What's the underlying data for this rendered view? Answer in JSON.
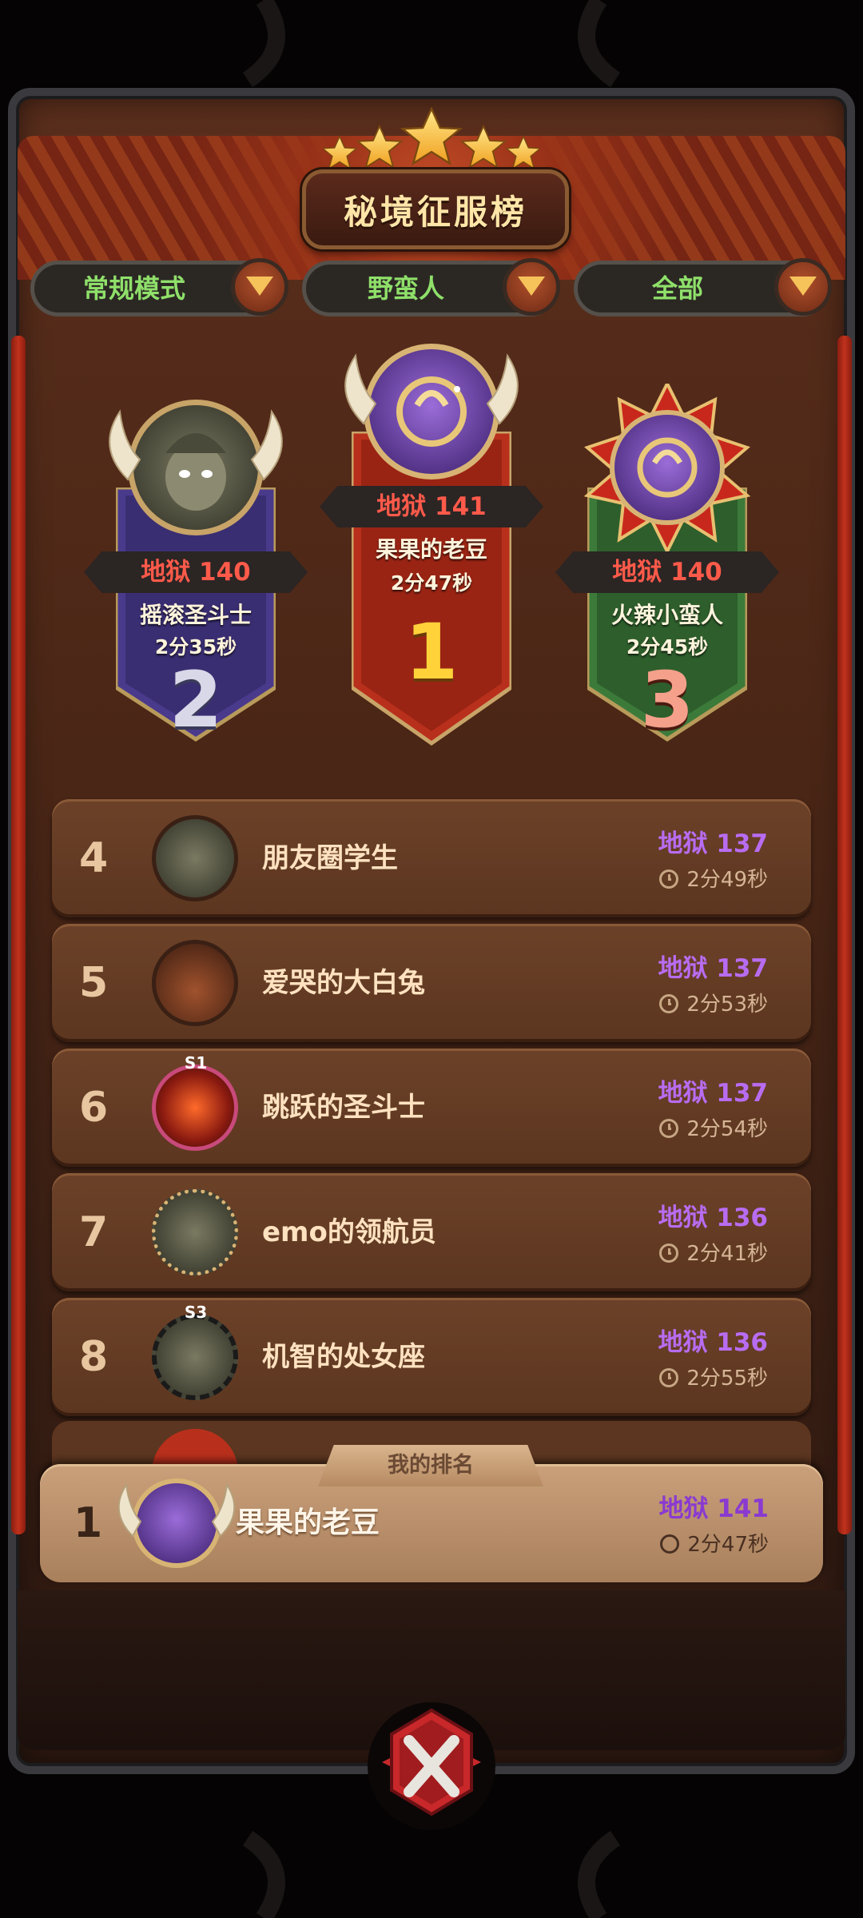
{
  "title": "秘境征服榜",
  "filters": [
    {
      "label": "常规模式"
    },
    {
      "label": "野蛮人"
    },
    {
      "label": "全部"
    }
  ],
  "podium": {
    "first": {
      "rank": "1",
      "level": "地狱 141",
      "name": "果果的老豆",
      "time": "2分47秒"
    },
    "second": {
      "rank": "2",
      "level": "地狱 140",
      "name": "摇滚圣斗士",
      "time": "2分35秒"
    },
    "third": {
      "rank": "3",
      "level": "地狱 140",
      "name": "火辣小蛮人",
      "time": "2分45秒"
    }
  },
  "ranking": [
    {
      "rank": "4",
      "name": "朋友圈学生",
      "level": "地狱 137",
      "time": "2分49秒"
    },
    {
      "rank": "5",
      "name": "爱哭的大白兔",
      "level": "地狱 137",
      "time": "2分53秒"
    },
    {
      "rank": "6",
      "name": "跳跃的圣斗士",
      "level": "地狱 137",
      "time": "2分54秒",
      "badge": "S1"
    },
    {
      "rank": "7",
      "name": "emo的领航员",
      "level": "地狱 136",
      "time": "2分41秒"
    },
    {
      "rank": "8",
      "name": "机智的处女座",
      "level": "地狱 136",
      "time": "2分55秒",
      "badge": "S3"
    }
  ],
  "my_rank": {
    "tab_label": "我的排名",
    "rank": "1",
    "name": "果果的老豆",
    "level": "地狱 141",
    "time": "2分47秒"
  },
  "colors": {
    "level_purple": "#b86cf0",
    "level_red": "#ff5a4a",
    "filter_green": "#8fe06a",
    "panel_brown": "#4a2616"
  }
}
